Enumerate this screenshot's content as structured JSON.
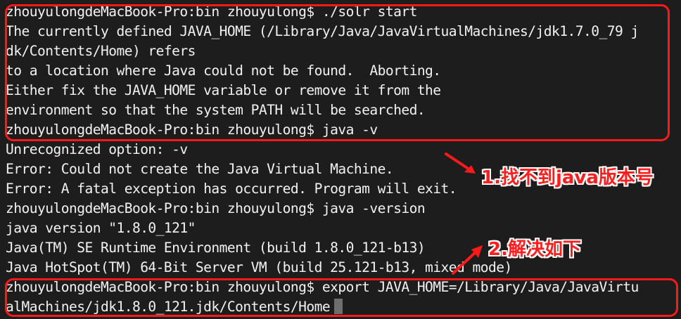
{
  "terminal": {
    "lines": [
      "zhouyulongdeMacBook-Pro:bin zhouyulong$ ./solr start",
      "The currently defined JAVA_HOME (/Library/Java/JavaVirtualMachines/jdk1.7.0_79 j",
      "dk/Contents/Home) refers",
      "to a location where Java could not be found.  Aborting.",
      "Either fix the JAVA_HOME variable or remove it from the",
      "environment so that the system PATH will be searched.",
      "zhouyulongdeMacBook-Pro:bin zhouyulong$ java -v",
      "Unrecognized option: -v",
      "Error: Could not create the Java Virtual Machine.",
      "Error: A fatal exception has occurred. Program will exit.",
      "zhouyulongdeMacBook-Pro:bin zhouyulong$ java -version",
      "java version \"1.8.0_121\"",
      "Java(TM) SE Runtime Environment (build 1.8.0_121-b13)",
      "Java HotSpot(TM) 64-Bit Server VM (build 25.121-b13, mixed mode)",
      "zhouyulongdeMacBook-Pro:bin zhouyulong$ export JAVA_HOME=/Library/Java/JavaVirtu",
      "alMachines/jdk1.8.0_121.jdk/Contents/Home"
    ]
  },
  "annotations": {
    "label1": "1.找不到java版本号",
    "label2": "2.解决如下"
  },
  "colors": {
    "background": "#1d1d1d",
    "text": "#f2f2f2",
    "annotation": "#ff1a1a",
    "cursor": "#6e6e6e"
  }
}
